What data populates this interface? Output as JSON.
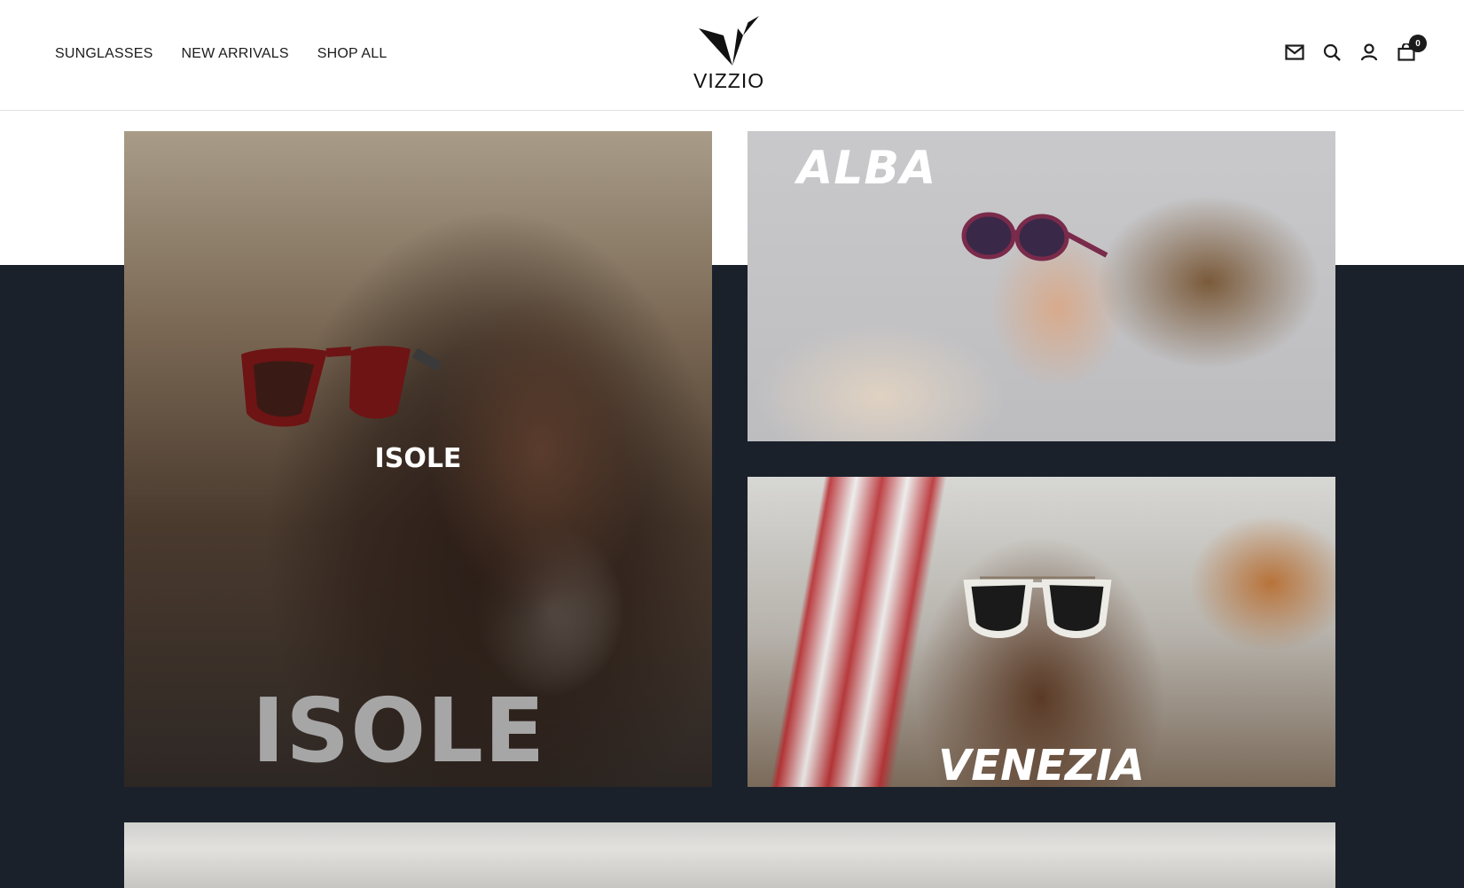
{
  "header": {
    "nav": [
      {
        "label": "SUNGLASSES"
      },
      {
        "label": "NEW ARRIVALS"
      },
      {
        "label": "SHOP ALL"
      }
    ],
    "logo_text": "VIZZIO",
    "icons": [
      "mail-icon",
      "search-icon",
      "account-icon",
      "cart-icon"
    ],
    "cart_count": "0"
  },
  "collections": {
    "isole": {
      "label_small": "ISOLE",
      "label_big": "ISOLE"
    },
    "alba": {
      "label": "ALBA"
    },
    "venezia": {
      "label": "VENEZIA"
    }
  },
  "colors": {
    "dark_band": "#1a212b",
    "header_bg": "#ffffff",
    "text": "#1c1c1c"
  }
}
